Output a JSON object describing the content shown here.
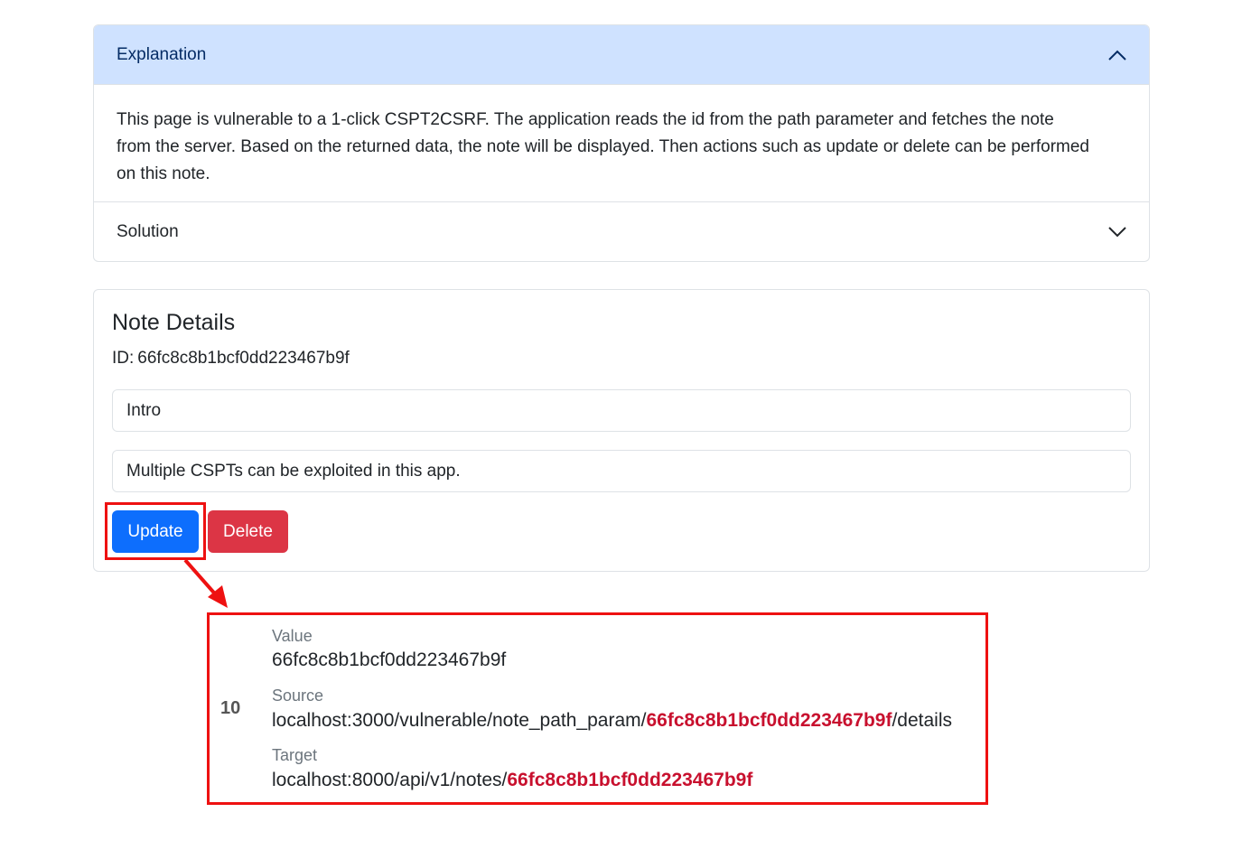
{
  "accordion": {
    "explanation": {
      "title": "Explanation",
      "body": "This page is vulnerable to a 1-click CSPT2CSRF. The application reads the id from the path parameter and fetches the note from the server. Based on the returned data, the note will be displayed. Then actions such as update or delete can be performed on this note."
    },
    "solution": {
      "title": "Solution"
    }
  },
  "note": {
    "heading": "Note Details",
    "id_label": "ID:",
    "id_value": "66fc8c8b1bcf0dd223467b9f",
    "title_value": "Intro",
    "content_value": "Multiple CSPTs can be exploited in this app.",
    "update_label": "Update",
    "delete_label": "Delete"
  },
  "finding": {
    "row_number": "10",
    "value_label": "Value",
    "value": "66fc8c8b1bcf0dd223467b9f",
    "source_label": "Source",
    "source_prefix": "localhost:3000/vulnerable/note_path_param/",
    "source_highlight": "66fc8c8b1bcf0dd223467b9f",
    "source_suffix": "/details",
    "target_label": "Target",
    "target_prefix": "localhost:8000/api/v1/notes/",
    "target_highlight": "66fc8c8b1bcf0dd223467b9f"
  },
  "colors": {
    "primary": "#0d6efd",
    "danger": "#dc3545",
    "accordion_active_bg": "#cfe2ff",
    "annotation_red": "#ee1111",
    "highlight_text": "#c8102e"
  }
}
